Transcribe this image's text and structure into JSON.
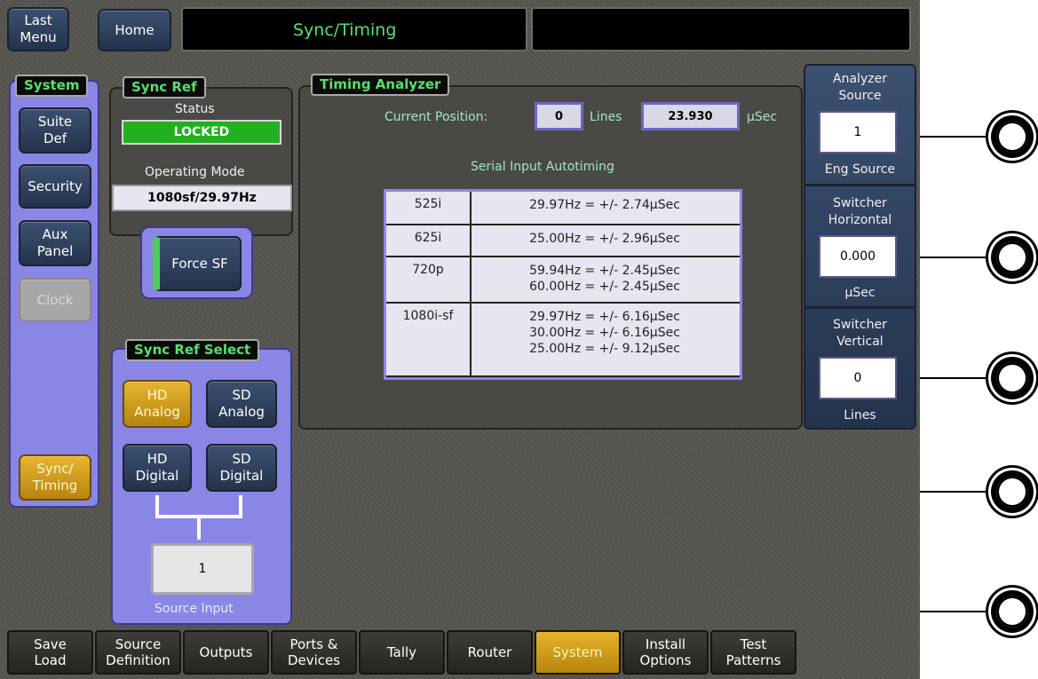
{
  "top_bar": {
    "last_menu": "Last\nMenu",
    "home": "Home",
    "title": "Sync/Timing"
  },
  "system_sidebar": {
    "title": "System",
    "items": [
      {
        "label": "Suite\nDef"
      },
      {
        "label": "Security"
      },
      {
        "label": "Aux\nPanel"
      },
      {
        "label": "Clock"
      },
      {
        "label": "Sync/\nTiming"
      }
    ]
  },
  "sync_ref": {
    "title": "Sync Ref",
    "status_label": "Status",
    "status_value": "LOCKED",
    "status_color": "#22b020",
    "operating_mode_label": "Operating Mode",
    "operating_mode_value": "1080sf/29.97Hz"
  },
  "force_sf": {
    "label": "Force SF"
  },
  "sync_ref_select": {
    "title": "Sync Ref Select",
    "buttons": [
      {
        "label": "HD\nAnalog"
      },
      {
        "label": "SD\nAnalog"
      },
      {
        "label": "HD\nDigital"
      },
      {
        "label": "SD\nDigital"
      }
    ],
    "source_value": "1",
    "source_label": "Source Input"
  },
  "timing_analyzer": {
    "title": "Timing Analyzer",
    "current_position_label": "Current Position:",
    "lines_value": "0",
    "lines_unit": "Lines",
    "usec_value": "23.930",
    "usec_unit": "µSec",
    "autotiming_title": "Serial Input Autotiming",
    "rows": [
      {
        "format": "525i",
        "values": "29.97Hz = +/- 2.74µSec"
      },
      {
        "format": "625i",
        "values": "25.00Hz = +/- 2.96µSec"
      },
      {
        "format": "720p",
        "values": "59.94Hz = +/- 2.45µSec\n60.00Hz = +/- 2.45µSec"
      },
      {
        "format": "1080i-sf",
        "values": "29.97Hz = +/- 6.16µSec\n30.00Hz = +/- 6.16µSec\n25.00Hz = +/- 9.12µSec"
      }
    ]
  },
  "right_panel": {
    "analyzer_source": {
      "label": "Analyzer\nSource",
      "value": "1",
      "sub": "Eng Source"
    },
    "switcher_horizontal": {
      "label": "Switcher\nHorizontal",
      "value": "0.000",
      "sub": "µSec"
    },
    "switcher_vertical": {
      "label": "Switcher\nVertical",
      "value": "0",
      "sub": "Lines"
    }
  },
  "bottom_nav": [
    {
      "label": "Save\nLoad"
    },
    {
      "label": "Source\nDefinition"
    },
    {
      "label": "Outputs"
    },
    {
      "label": "Ports &\nDevices"
    },
    {
      "label": "Tally"
    },
    {
      "label": "Router"
    },
    {
      "label": "System"
    },
    {
      "label": "Install\nOptions"
    },
    {
      "label": "Test\nPatterns"
    }
  ],
  "colors": {
    "accent_gold": "#e0aa20",
    "panel_lavender": "#8a86e6",
    "label_green": "#58e06a"
  }
}
